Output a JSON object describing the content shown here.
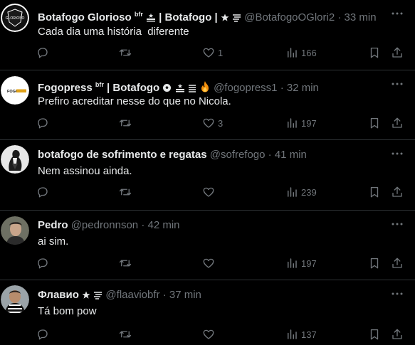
{
  "tweets": [
    {
      "name": "Botafogo Glorioso",
      "badge": "bfr",
      "name_suffix": "| Botafogo |",
      "handle": "@BotafogoOGlori2",
      "separator": "·",
      "time": "33 min",
      "text": "Cada dia uma história  diferente",
      "replies": "",
      "retweets": "",
      "likes": "1",
      "views": "166",
      "avatar_text": "GLORIOSO"
    },
    {
      "name": "Fogopress",
      "badge": "bfr",
      "name_suffix": "| Botafogo",
      "handle": "@fogopress1",
      "separator": "·",
      "time": "32 min",
      "text": "Prefiro acreditar nesse do que no Nicola.",
      "replies": "",
      "retweets": "",
      "likes": "3",
      "views": "197",
      "avatar_text": "FOGO"
    },
    {
      "name": "botafogo de sofrimento e regatas",
      "handle": "@sofrefogo",
      "separator": "·",
      "time": "41 min",
      "text": "Nem assinou ainda.",
      "replies": "",
      "retweets": "",
      "likes": "",
      "views": "239"
    },
    {
      "name": "Pedro",
      "handle": "@pedronnson",
      "separator": "·",
      "time": "42 min",
      "text": "ai sim.",
      "replies": "",
      "retweets": "",
      "likes": "",
      "views": "197"
    },
    {
      "name": "Флавио",
      "handle": "@flaaviobfr",
      "separator": "·",
      "time": "37 min",
      "text": "Tá bom pow",
      "replies": "",
      "retweets": "",
      "likes": "",
      "views": "137"
    }
  ],
  "icons": {
    "more": "more-dots-icon",
    "reply": "reply-icon",
    "retweet": "retweet-icon",
    "like": "heart-icon",
    "views": "views-icon",
    "bookmark": "bookmark-icon",
    "share": "share-icon",
    "star": "star-icon",
    "lone_star": "lone-star-flag-icon",
    "fire": "fire-emoji-icon",
    "soccer": "soccer-ball-icon"
  },
  "colors": {
    "background": "#000000",
    "text": "#e7e9ea",
    "muted": "#71767b",
    "divider": "#2f3336"
  }
}
